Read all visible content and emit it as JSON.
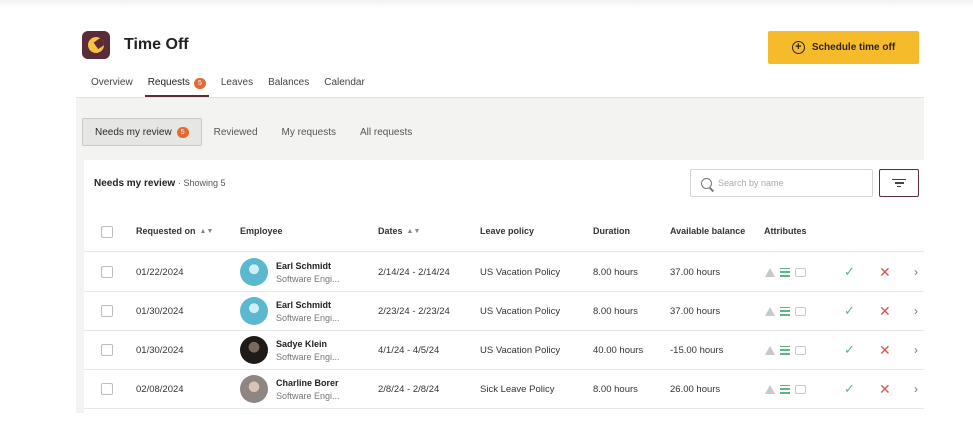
{
  "app": {
    "title": "Time Off",
    "icon": "time-off-app-icon"
  },
  "actions": {
    "schedule_label": "Schedule time off",
    "schedule_icon": "plus-circle-icon"
  },
  "tabs": [
    {
      "label": "Overview"
    },
    {
      "label": "Requests",
      "badge": "5"
    },
    {
      "label": "Leaves"
    },
    {
      "label": "Balances"
    },
    {
      "label": "Calendar"
    }
  ],
  "subtabs": [
    {
      "label": "Needs my review",
      "badge": "5"
    },
    {
      "label": "Reviewed"
    },
    {
      "label": "My requests"
    },
    {
      "label": "All requests"
    }
  ],
  "panel": {
    "title": "Needs my review",
    "showing": "· Showing 5"
  },
  "search": {
    "placeholder": "Search by name"
  },
  "columns": {
    "requested_on": "Requested on",
    "employee": "Employee",
    "dates": "Dates",
    "leave_policy": "Leave policy",
    "duration": "Duration",
    "available_balance": "Available balance",
    "attributes": "Attributes"
  },
  "rows": [
    {
      "requested_on": "01/22/2024",
      "name": "Earl Schmidt",
      "title": "Software Engi...",
      "dates": "2/14/24 - 2/14/24",
      "policy": "US Vacation Policy",
      "duration": "8.00 hours",
      "balance": "37.00 hours"
    },
    {
      "requested_on": "01/30/2024",
      "name": "Earl Schmidt",
      "title": "Software Engi...",
      "dates": "2/23/24 - 2/23/24",
      "policy": "US Vacation Policy",
      "duration": "8.00 hours",
      "balance": "37.00 hours"
    },
    {
      "requested_on": "01/30/2024",
      "name": "Sadye Klein",
      "title": "Software Engi...",
      "dates": "4/1/24 - 4/5/24",
      "policy": "US Vacation Policy",
      "duration": "40.00 hours",
      "balance": "-15.00 hours"
    },
    {
      "requested_on": "02/08/2024",
      "name": "Charline Borer",
      "title": "Software Engi...",
      "dates": "2/8/24 - 2/8/24",
      "policy": "Sick Leave Policy",
      "duration": "8.00 hours",
      "balance": "26.00 hours"
    }
  ],
  "colors": {
    "brand": "#5a2b38",
    "accent": "#f6bb2a",
    "badge": "#e36a35",
    "approve": "#5fb37e",
    "deny": "#d9534f"
  }
}
